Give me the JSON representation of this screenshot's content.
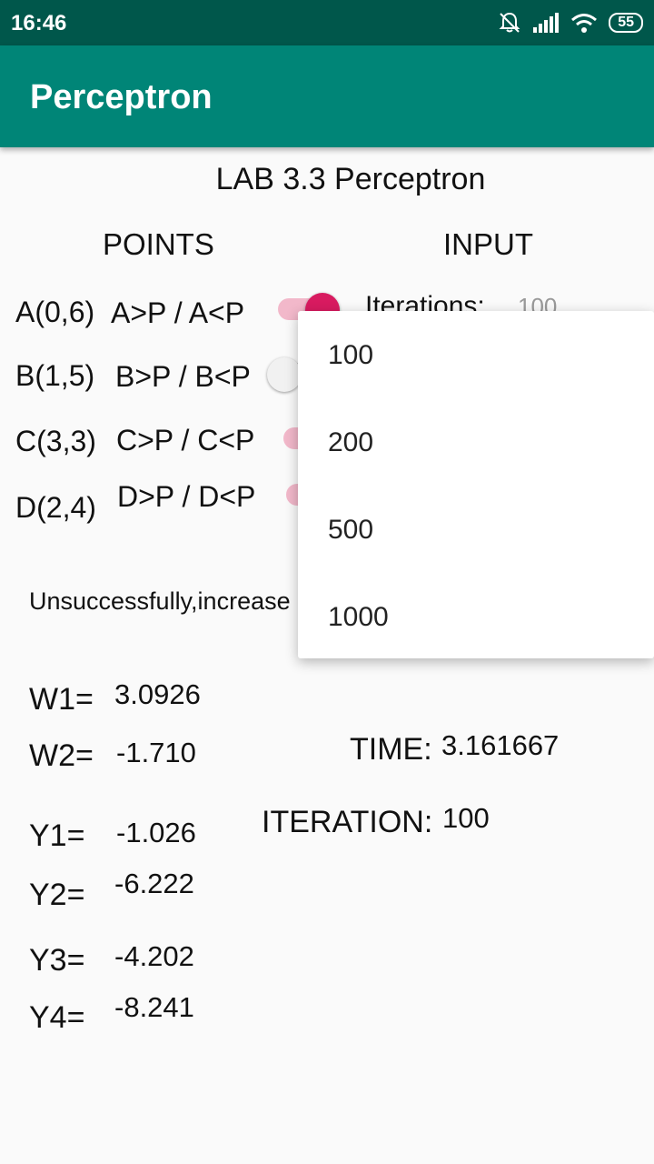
{
  "status_bar": {
    "time": "16:46",
    "battery": "55"
  },
  "app_bar": {
    "title": "Perceptron"
  },
  "main": {
    "title": "LAB 3.3 Perceptron",
    "points_header": "POINTS",
    "input_header": "INPUT",
    "points": [
      {
        "label": "A(0,6)",
        "compare": "A>P / A<P",
        "switch_on": true
      },
      {
        "label": "B(1,5)",
        "compare": "B>P / B<P",
        "switch_on": false
      },
      {
        "label": "C(3,3)",
        "compare": "C>P / C<P",
        "switch_on": true
      },
      {
        "label": "D(2,4)",
        "compare": "D>P / D<P",
        "switch_on": true
      }
    ],
    "iterations_label": "Iterations:",
    "iterations_value": "100",
    "status_message": "Unsuccessfully,increase",
    "weights": {
      "w1_label": "W1=",
      "w1_value": "3.0926",
      "w2_label": "W2=",
      "w2_value": "-1.710"
    },
    "outputs": {
      "y1_label": "Y1=",
      "y1_value": "-1.026",
      "y2_label": "Y2=",
      "y2_value": "-6.222",
      "y3_label": "Y3=",
      "y3_value": "-4.202",
      "y4_label": "Y4=",
      "y4_value": "-8.241"
    },
    "time_label": "TIME:",
    "time_value": "3.161667",
    "iteration_label": "ITERATION:",
    "iteration_value": "100"
  },
  "dropdown": {
    "options": [
      "100",
      "200",
      "500",
      "1000"
    ]
  },
  "colors": {
    "status_bar": "#00574b",
    "app_bar": "#008577",
    "accent": "#d81b60"
  }
}
